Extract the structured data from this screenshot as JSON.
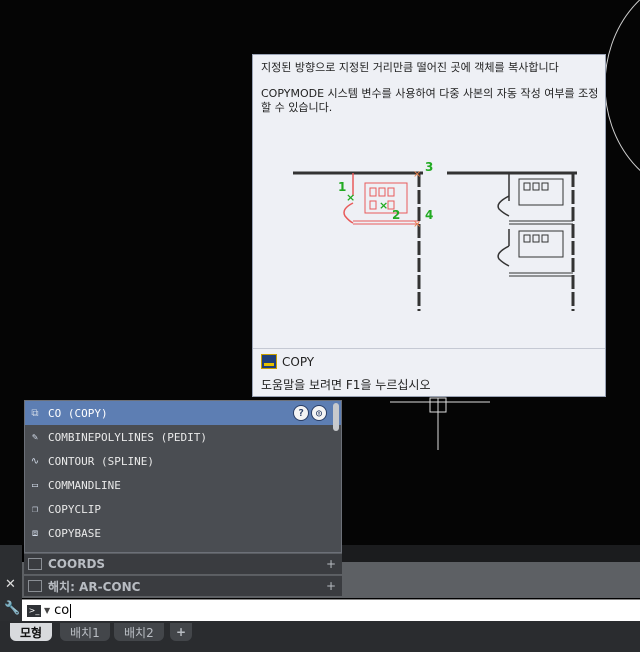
{
  "tooltip": {
    "description_1": "지정된 방향으로 지정된 거리만큼 떨어진 곳에 객체를 복사합니다",
    "description_2": "COPYMODE 시스템 변수를 사용하여 다중 사본의 자동 작성 여부를 조정할 수 있습니다.",
    "figure_labels": [
      "1",
      "2",
      "3",
      "4"
    ],
    "command_name": "COPY",
    "help_text": "도움말을 보려면 F1을 누르십시오"
  },
  "autocomplete": {
    "items": [
      {
        "label": "CO (COPY)",
        "icon": "copy-icon"
      },
      {
        "label": "COMBINEPOLYLINES (PEDIT)",
        "icon": "pedit-icon"
      },
      {
        "label": "CONTOUR (SPLINE)",
        "icon": "spline-icon"
      },
      {
        "label": "COMMANDLINE",
        "icon": "commandline-icon"
      },
      {
        "label": "COPYCLIP",
        "icon": "copyclip-icon"
      },
      {
        "label": "COPYBASE",
        "icon": "copybase-icon"
      }
    ],
    "help_button": "?"
  },
  "panels": {
    "coords": "COORDS",
    "hatch": "해치: AR-CONC"
  },
  "command_line": {
    "value": "co"
  },
  "tabs": [
    "모형",
    "배치1",
    "배치2",
    "+"
  ],
  "colors": {
    "accent": "#5d7eb3",
    "figure_marker": "#22aa22",
    "figure_highlight": "#e85a5a"
  }
}
